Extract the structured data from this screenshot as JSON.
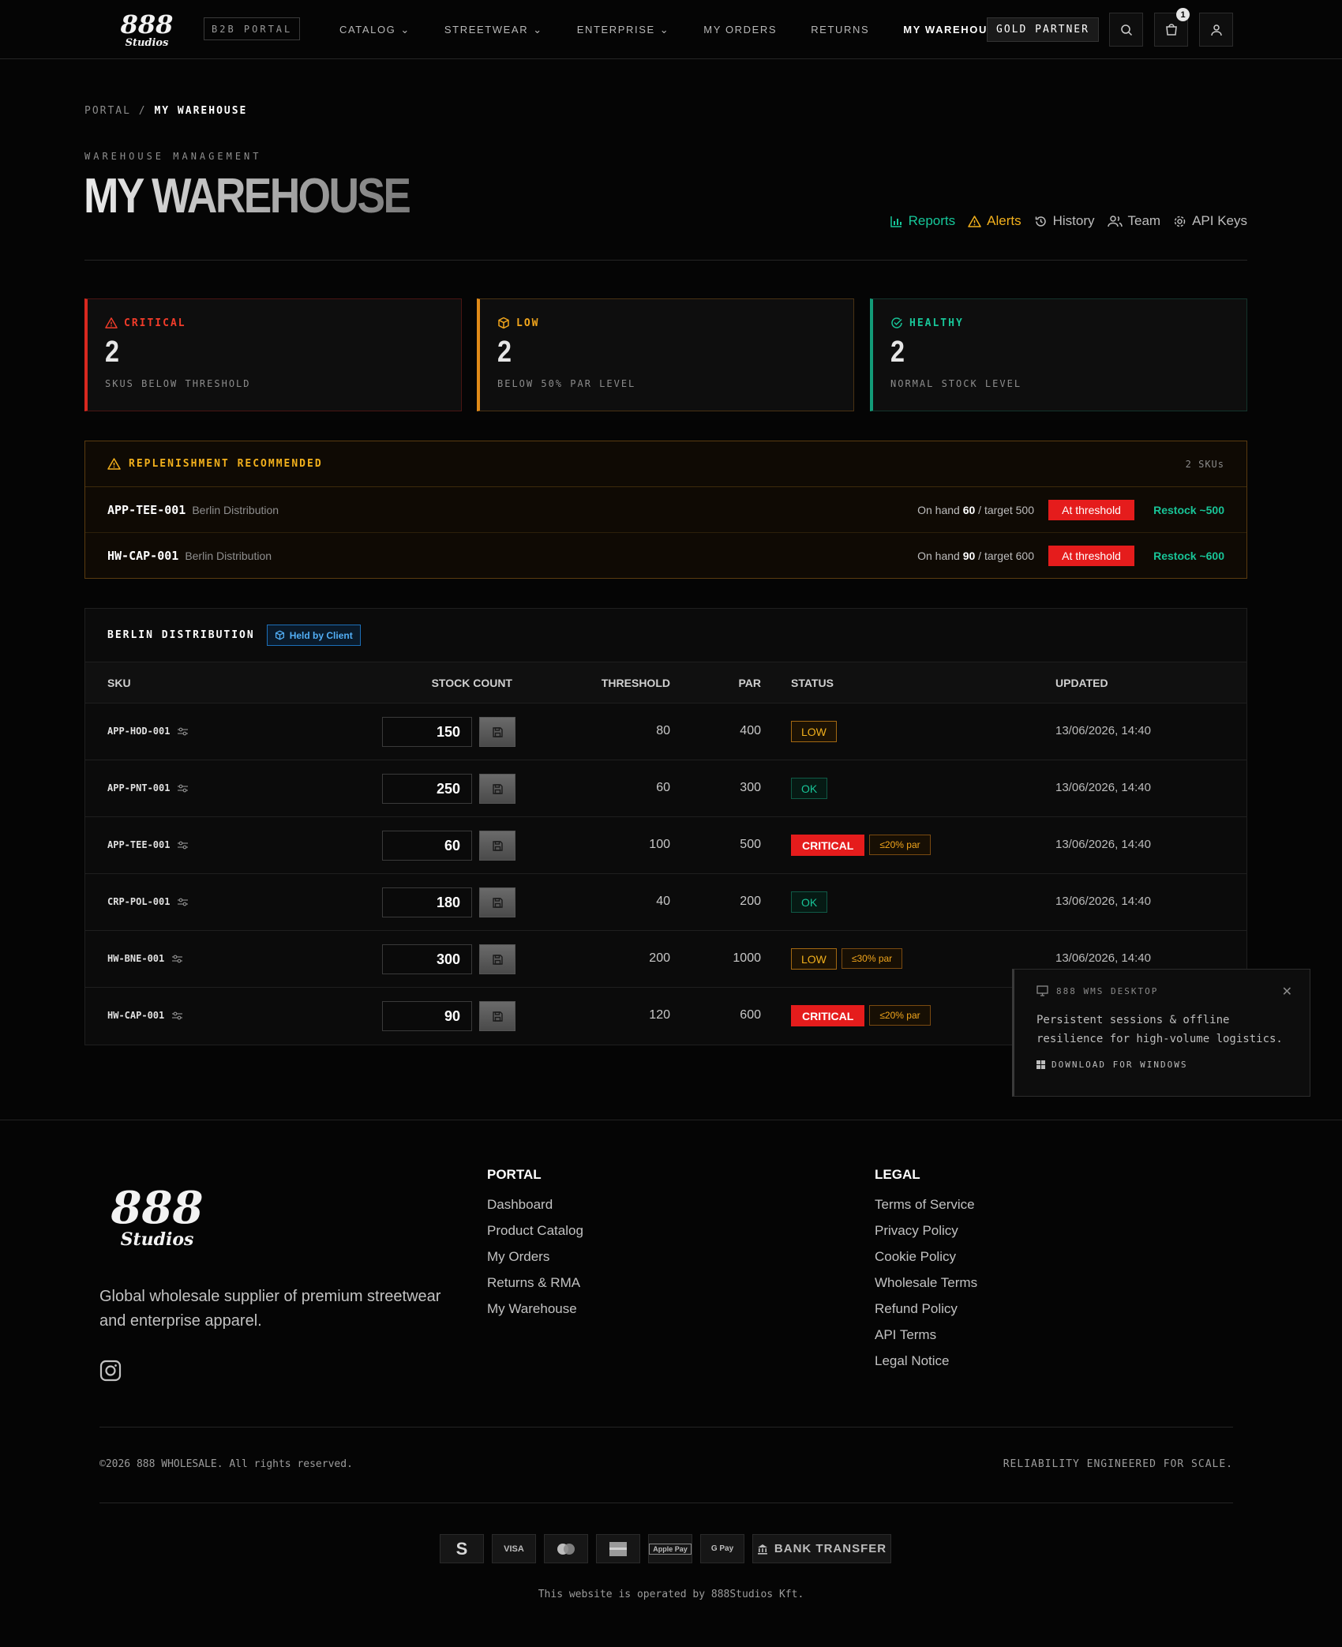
{
  "nav": {
    "brand": "888 Studios",
    "portal_badge": "B2B PORTAL",
    "menu": [
      {
        "label": "CATALOG",
        "dropdown": true
      },
      {
        "label": "STREETWEAR",
        "dropdown": true
      },
      {
        "label": "ENTERPRISE",
        "dropdown": true
      },
      {
        "label": "MY ORDERS",
        "dropdown": false
      },
      {
        "label": "RETURNS",
        "dropdown": false
      },
      {
        "label": "MY WAREHOUSE",
        "dropdown": false,
        "active": true
      }
    ],
    "partner_badge": "GOLD PARTNER",
    "cart_count": "1"
  },
  "header": {
    "breadcrumb_root": "PORTAL",
    "breadcrumb_sep": "/",
    "breadcrumb_current": "MY WAREHOUSE",
    "eyebrow": "WAREHOUSE MANAGEMENT",
    "title": "MY WAREHOUSE",
    "tabs": [
      "Reports",
      "Alerts",
      "History",
      "Team",
      "API Keys"
    ]
  },
  "stats": {
    "critical": {
      "label": "CRITICAL",
      "value": "2",
      "sub": "SKUS BELOW THRESHOLD"
    },
    "low": {
      "label": "LOW",
      "value": "2",
      "sub": "BELOW 50% PAR LEVEL"
    },
    "healthy": {
      "label": "HEALTHY",
      "value": "2",
      "sub": "NORMAL STOCK LEVEL"
    }
  },
  "replenishment": {
    "title": "REPLENISHMENT RECOMMENDED",
    "count": "2 SKUs",
    "items": [
      {
        "sku": "APP-TEE-001",
        "warehouse": "Berlin Distribution",
        "on_hand_label": "On hand",
        "on_hand": "60",
        "target": "/ target 500",
        "badge": "At threshold",
        "restock": "Restock ~500"
      },
      {
        "sku": "HW-CAP-001",
        "warehouse": "Berlin Distribution",
        "on_hand_label": "On hand",
        "on_hand": "90",
        "target": "/ target 600",
        "badge": "At threshold",
        "restock": "Restock ~600"
      }
    ]
  },
  "table": {
    "title": "BERLIN DISTRIBUTION",
    "held_badge": "Held by Client",
    "columns": [
      "SKU",
      "STOCK COUNT",
      "THRESHOLD",
      "PAR",
      "STATUS",
      "UPDATED"
    ],
    "rows": [
      {
        "sku": "APP-HOD-001",
        "stock": "150",
        "threshold": "80",
        "par": "400",
        "status": "LOW",
        "par_note": "",
        "updated": "13/06/2026, 14:40"
      },
      {
        "sku": "APP-PNT-001",
        "stock": "250",
        "threshold": "60",
        "par": "300",
        "status": "OK",
        "par_note": "",
        "updated": "13/06/2026, 14:40"
      },
      {
        "sku": "APP-TEE-001",
        "stock": "60",
        "threshold": "100",
        "par": "500",
        "status": "CRITICAL",
        "par_note": "≤20% par",
        "updated": "13/06/2026, 14:40"
      },
      {
        "sku": "CRP-POL-001",
        "stock": "180",
        "threshold": "40",
        "par": "200",
        "status": "OK",
        "par_note": "",
        "updated": "13/06/2026, 14:40"
      },
      {
        "sku": "HW-BNE-001",
        "stock": "300",
        "threshold": "200",
        "par": "1000",
        "status": "LOW",
        "par_note": "≤30% par",
        "updated": "13/06/2026, 14:40"
      },
      {
        "sku": "HW-CAP-001",
        "stock": "90",
        "threshold": "120",
        "par": "600",
        "status": "CRITICAL",
        "par_note": "≤20% par",
        "updated": ""
      }
    ]
  },
  "popup": {
    "title": "888 WMS DESKTOP",
    "text": "Persistent sessions & offline resilience for high-volume logistics.",
    "download": "DOWNLOAD FOR WINDOWS"
  },
  "footer": {
    "tagline": "Global wholesale supplier of premium streetwear and enterprise apparel.",
    "portal_heading": "PORTAL",
    "portal_links": [
      "Dashboard",
      "Product Catalog",
      "My Orders",
      "Returns & RMA",
      "My Warehouse"
    ],
    "legal_heading": "LEGAL",
    "legal_links": [
      "Terms of Service",
      "Privacy Policy",
      "Cookie Policy",
      "Wholesale Terms",
      "Refund Policy",
      "API Terms",
      "Legal Notice"
    ],
    "copyright": "©2026 888 WHOLESALE. All rights reserved.",
    "reliability": "RELIABILITY ENGINEERED FOR SCALE.",
    "payments": [
      "S",
      "VISA",
      "mastercard",
      "AMEX",
      "Apple Pay",
      "G Pay"
    ],
    "bank_transfer": "BANK TRANSFER",
    "operated_by": "This website is operated by 888Studios Kft."
  },
  "colors": {
    "critical": "#e51c1c",
    "low": "#f2b01c",
    "healthy": "#18c497",
    "info": "#52aef5"
  }
}
